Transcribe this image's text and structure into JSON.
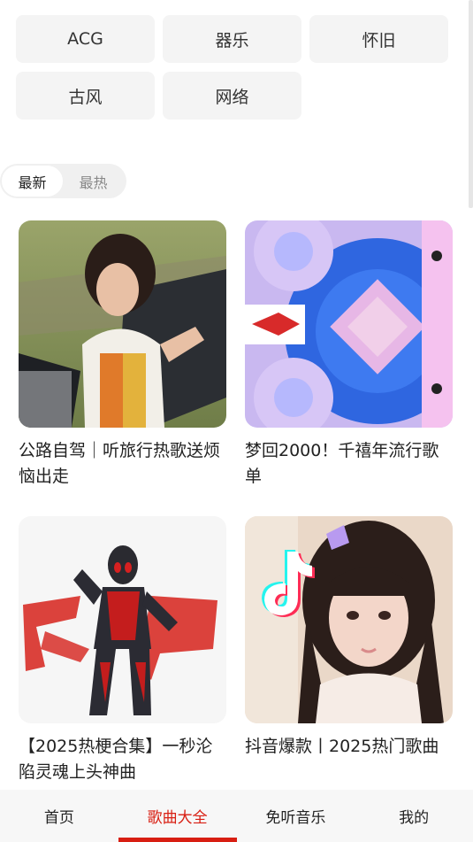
{
  "genres": [
    "ACG",
    "器乐",
    "怀旧",
    "古风",
    "网络"
  ],
  "sort": {
    "options": [
      "最新",
      "最热"
    ],
    "selected": "最新"
  },
  "playlists": [
    {
      "title": "公路自驾｜听旅行热歌送烦恼出走",
      "cover": "woman-in-car-cover"
    },
    {
      "title": "梦回2000！千禧年流行歌单",
      "cover": "y2k-vinyl-cover"
    },
    {
      "title": "【2025热梗合集】一秒沦陷灵魂上头神曲",
      "cover": "ultraman-cover"
    },
    {
      "title": "抖音爆款丨2025热门歌曲",
      "cover": "tiktok-girl-cover"
    }
  ],
  "tabs": [
    {
      "label": "首页",
      "active": false
    },
    {
      "label": "歌曲大全",
      "active": true
    },
    {
      "label": "免听音乐",
      "active": false
    },
    {
      "label": "我的",
      "active": false
    }
  ],
  "colors": {
    "accent": "#d81e12",
    "chip_bg": "#f4f4f4",
    "tabbar_bg": "#f7f7f7"
  }
}
